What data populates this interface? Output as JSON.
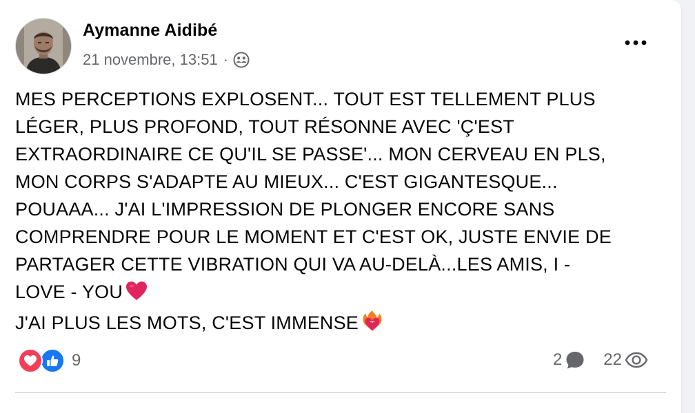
{
  "post": {
    "author": "Aymanne Aidibé",
    "timestamp": "21 novembre, 13:51",
    "separator": "·",
    "audience_icon": "friends-icon",
    "more_icon": "more-horizontal-icon",
    "text_lines": [
      "MES PERCEPTIONS EXPLOSENT... TOUT EST TELLEMENT PLUS",
      "LÉGER, PLUS PROFOND, TOUT RÉSONNE AVEC 'Ç'EST",
      "EXTRAORDINAIRE CE QU'IL SE PASSE'... MON CERVEAU EN PLS,",
      "MON CORPS S'ADAPTE AU MIEUX... C'EST GIGANTESQUE...",
      "POUAAA... J'AI L'IMPRESSION DE PLONGER ENCORE SANS",
      "COMPRENDRE POUR LE MOMENT ET C'EST OK, JUSTE ENVIE DE",
      "PARTAGER CETTE VIBRATION QUI VA AU-DELÀ...LES AMIS, I -",
      "LOVE - YOU",
      "J'AI PLUS LES MOTS, C'EST IMMENSE"
    ],
    "emojis": {
      "line_8": "red-heart-emoji",
      "line_9": "heart-on-fire-emoji"
    }
  },
  "reactions": {
    "icons": [
      "love-reaction-icon",
      "like-reaction-icon"
    ],
    "count": "9"
  },
  "stats": {
    "comments": "2",
    "comment_icon": "comment-icon",
    "views": "22",
    "view_icon": "eye-icon"
  },
  "colors": {
    "text": "#050505",
    "secondary": "#65676b",
    "love": "#f33e58",
    "like": "#1877f2",
    "heart": "#e0245e",
    "background": "#f0f2f5"
  }
}
